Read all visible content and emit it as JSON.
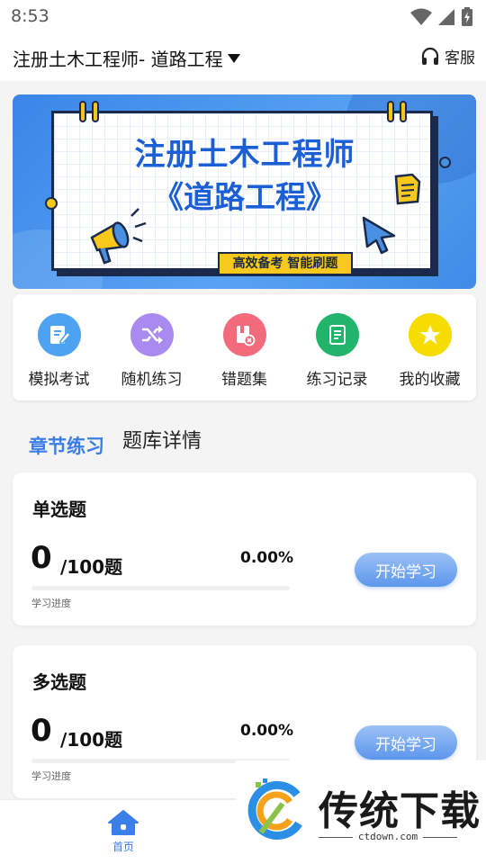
{
  "status_bar": {
    "time": "8:53",
    "icons": [
      "wifi-icon",
      "signal-icon",
      "battery-icon"
    ]
  },
  "header": {
    "title": "注册土木工程师- 道路工程",
    "dropdown_icon": "caret-down-icon",
    "service_label": "客服",
    "service_icon": "headset-icon"
  },
  "banner": {
    "line1": "注册土木工程师",
    "line2": "《道路工程》",
    "tag": "高效备考 智能刷题"
  },
  "quick_actions": [
    {
      "label": "模拟考试",
      "icon": "exam-edit-icon",
      "color": "#4ea3f1"
    },
    {
      "label": "随机练习",
      "icon": "shuffle-icon",
      "color": "#a98bf0"
    },
    {
      "label": "错题集",
      "icon": "wrong-book-icon",
      "color": "#f26b7d"
    },
    {
      "label": "练习记录",
      "icon": "record-icon",
      "color": "#22b46a"
    },
    {
      "label": "我的收藏",
      "icon": "star-icon",
      "color": "#f7dc00"
    }
  ],
  "tabs": {
    "active": "章节练习",
    "inactive": "题库详情"
  },
  "sections": [
    {
      "title": "单选题",
      "done": "0",
      "total": "/100题",
      "percent": "0.00%",
      "progress": 0,
      "progress_label": "学习进度",
      "button": "开始学习"
    },
    {
      "title": "多选题",
      "done": "0",
      "total": "/100题",
      "percent": "0.00%",
      "progress": 0,
      "progress_label": "学习进度",
      "button": "开始学习"
    }
  ],
  "bottom_nav": {
    "home_label": "首页",
    "home_icon": "home-icon"
  },
  "watermark": {
    "text": "传统下载",
    "url": "ctdown.com"
  },
  "colors": {
    "accent": "#3b7ee8",
    "banner_blue": "#3a86e8",
    "banner_yellow": "#f8c91a"
  }
}
